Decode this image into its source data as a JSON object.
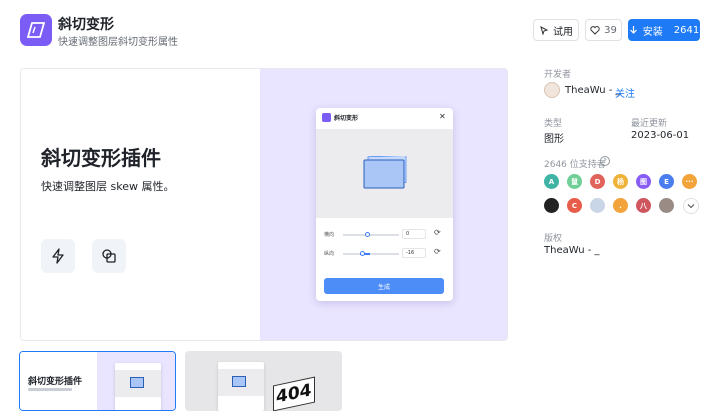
{
  "header": {
    "title": "斜切变形",
    "subtitle": "快速调整图层斜切变形属性",
    "try_label": "试用",
    "like_count": "39",
    "install_label": "安装",
    "install_count": "2641"
  },
  "cover": {
    "headline": "斜切变形插件",
    "tagline": "快速调整图层 skew 属性。",
    "panel": {
      "title": "斜切变形",
      "close": "✕",
      "row1_label": "横向",
      "row1_value": "0",
      "row2_label": "纵向",
      "row2_value": "-16",
      "generate": "生成"
    }
  },
  "thumbs": {
    "t1_headline": "斜切变形插件",
    "t2_text": "404"
  },
  "sidebar": {
    "developer_label": "开发者",
    "developer_name": "TheaWu - _",
    "follow": "关注",
    "type_label": "类型",
    "type_value": "图形",
    "updated_label": "最近更新",
    "updated_value": "2023-06-01",
    "supporters_label": "2646 位支持者",
    "supporters": [
      {
        "t": "A",
        "c": "#3fb3a4"
      },
      {
        "t": "鼠",
        "c": "#6fcf97"
      },
      {
        "t": "D",
        "c": "#e0645c"
      },
      {
        "t": "杨",
        "c": "#f0b33a"
      },
      {
        "t": "图",
        "c": "#8a5cf6"
      },
      {
        "t": "E",
        "c": "#4a7df0"
      },
      {
        "t": "···",
        "c": "#f2a33a"
      },
      {
        "t": "",
        "c": "#222222"
      },
      {
        "t": "C",
        "c": "#e85c4a"
      },
      {
        "t": "",
        "c": "#c9d6e8"
      },
      {
        "t": ".",
        "c": "#f2a33a"
      },
      {
        "t": "八",
        "c": "#d0565e"
      },
      {
        "t": "",
        "c": "#9a8b84"
      }
    ],
    "copyright_label": "版权",
    "copyright_value": "TheaWu - _"
  }
}
